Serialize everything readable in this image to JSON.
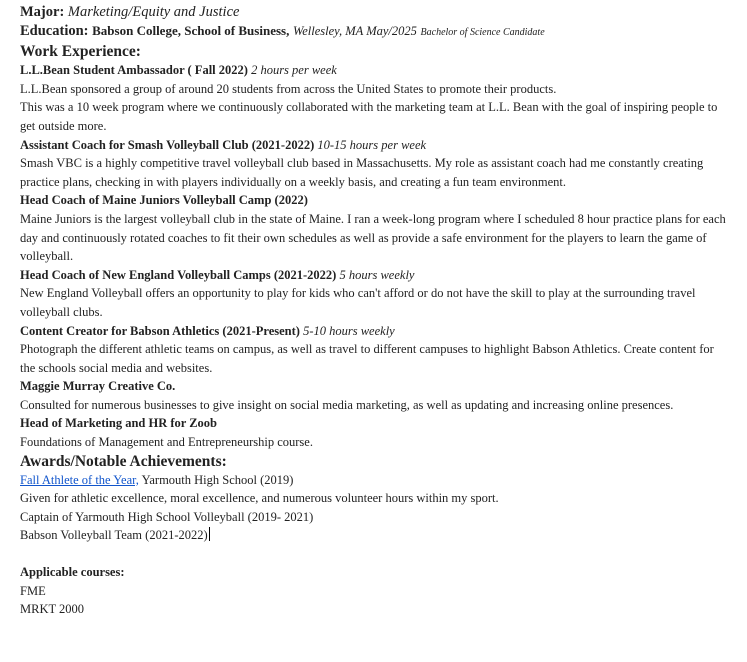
{
  "header": {
    "major_label": "Major:",
    "major_value": "Marketing/Equity and Justice",
    "education_label": "Education:",
    "education_school": "Babson College, School of Business,",
    "education_location": "Wellesley, MA May/2025",
    "education_degree": "Bachelor of Science Candidate"
  },
  "work_experience": {
    "heading": "Work Experience:",
    "jobs": [
      {
        "title": "L.L.Bean Student Ambassador ( Fall 2022)",
        "hours": "2 hours per week",
        "lines": [
          "L.L.Bean sponsored a group of around 20 students from across the United States to promote their products.",
          "This was a 10 week program where we continuously collaborated with the marketing team at L.L. Bean with the goal of inspiring people to get outside more."
        ]
      },
      {
        "title": "Assistant Coach for Smash Volleyball Club (2021-2022)",
        "hours": "10-15 hours per week",
        "lines": [
          "Smash VBC is a highly competitive travel volleyball club based in Massachusetts. My role as assistant coach had me constantly creating practice plans, checking in with players individually on a weekly basis, and creating a fun team environment."
        ]
      },
      {
        "title": "Head Coach of Maine Juniors Volleyball Camp (2022)",
        "hours": "",
        "lines": [
          "Maine Juniors is the largest volleyball club in the state of Maine. I ran a week-long program where I scheduled 8 hour practice plans for each day and continuously rotated coaches to fit their own schedules as well as provide a safe environment for the players to learn the game of volleyball."
        ]
      },
      {
        "title": "Head Coach of New England Volleyball Camps (2021-2022)",
        "hours": "5 hours weekly",
        "lines": [
          "New England Volleyball offers an opportunity to play for kids who can't afford or do not have the skill to play at the surrounding travel volleyball clubs."
        ]
      },
      {
        "title": "Content Creator for Babson Athletics (2021-Present)",
        "hours": "5-10 hours weekly",
        "lines": [
          "Photograph the different athletic teams on campus, as well as travel to different campuses to highlight Babson Athletics. Create content for the schools social media and websites."
        ]
      },
      {
        "title": "Maggie Murray Creative Co.",
        "hours": "",
        "lines": [
          "Consulted for numerous businesses to give insight on social media marketing, as well as updating and increasing online presences."
        ]
      },
      {
        "title": "Head of Marketing and HR for Zoob",
        "hours": "",
        "lines": [
          "Foundations of Management and Entrepreneurship course."
        ]
      }
    ]
  },
  "awards": {
    "heading": "Awards/Notable Achievements:",
    "link_text": "Fall Athlete of the Year,",
    "link_rest": " Yarmouth High School (2019)",
    "lines": [
      "Given for athletic excellence, moral excellence, and numerous volunteer hours within my sport.",
      "Captain of Yarmouth High School Volleyball  (2019- 2021)",
      "Babson Volleyball Team (2021-2022)"
    ]
  },
  "courses": {
    "heading": "Applicable courses:",
    "items": [
      "FME",
      "MRKT 2000"
    ]
  }
}
